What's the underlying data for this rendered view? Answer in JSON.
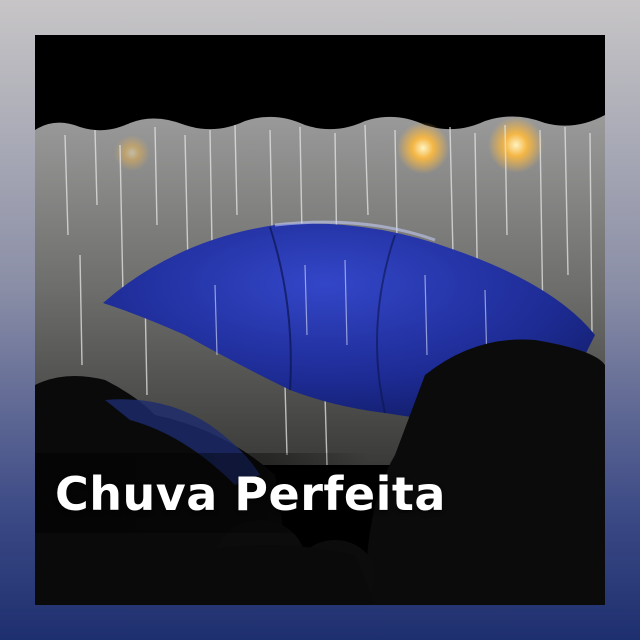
{
  "album": {
    "title": "Chuva Perfeita"
  },
  "colors": {
    "background_top": "#c7c5c6",
    "background_bottom": "#1e2f6f",
    "umbrella": "#1f2f9c",
    "rain": "#d9d9d9",
    "title_text": "#ffffff"
  }
}
